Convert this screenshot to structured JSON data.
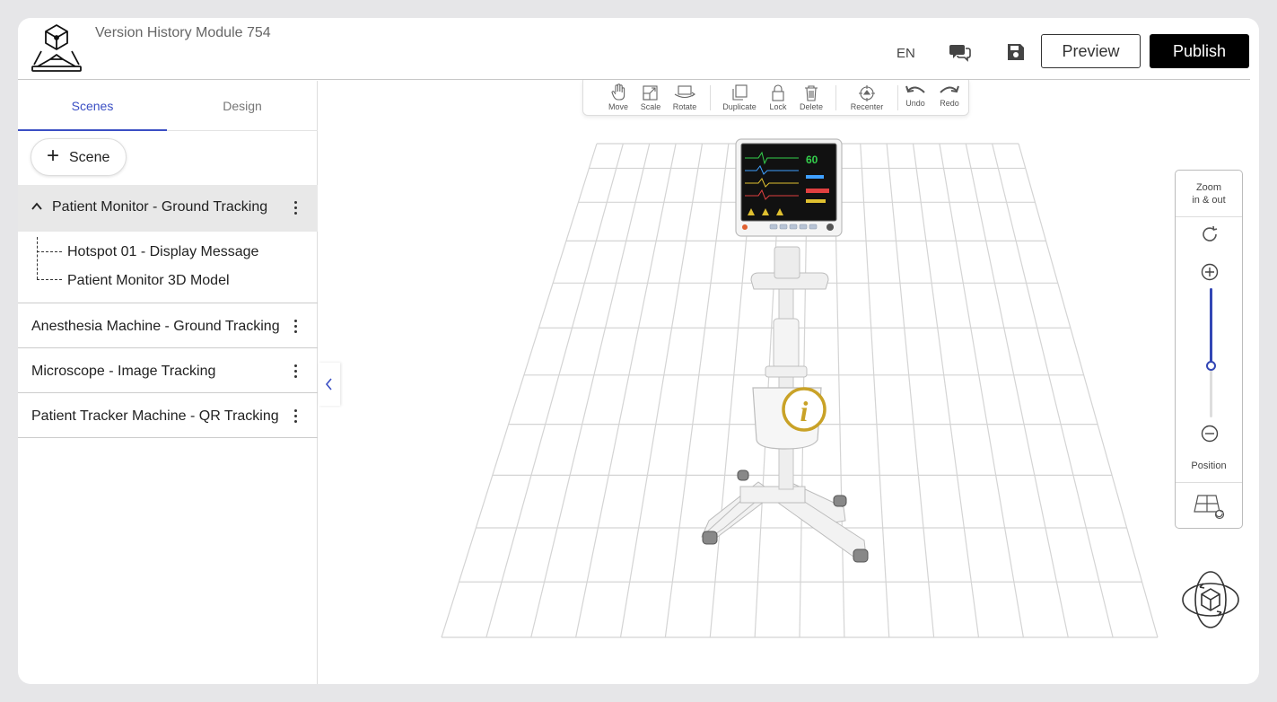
{
  "header": {
    "title": "Version History Module 754",
    "language": "EN",
    "preview_label": "Preview",
    "publish_label": "Publish"
  },
  "sidebar": {
    "tabs": [
      {
        "label": "Scenes",
        "active": true
      },
      {
        "label": "Design",
        "active": false
      }
    ],
    "add_scene_label": "Scene",
    "active_scene": {
      "name": "Patient Monitor - Ground Tracking",
      "children": [
        "Hotspot 01 - Display Message",
        "Patient Monitor 3D Model"
      ]
    },
    "scenes": [
      "Anesthesia Machine - Ground Tracking",
      "Microscope - Image Tracking",
      "Patient Tracker Machine - QR Tracking"
    ]
  },
  "toolbar": {
    "move": "Move",
    "scale": "Scale",
    "rotate": "Rotate",
    "duplicate": "Duplicate",
    "lock": "Lock",
    "delete": "Delete",
    "recenter": "Recenter",
    "undo": "Undo",
    "redo": "Redo"
  },
  "zoom_panel": {
    "title_line1": "Zoom",
    "title_line2": "in & out",
    "zoom_level": 0.6,
    "position_label": "Position"
  },
  "monitor_screen": {
    "hr": "60"
  },
  "colors": {
    "accent": "#3b4fc4",
    "hotspot": "#c9a227",
    "publish": "#000000"
  },
  "icons": {
    "logo": "ar-cube-logo-icon",
    "chat": "chat-icon",
    "save": "floppy-disk-icon",
    "reset": "refresh-icon",
    "zoom_in": "plus-circle-icon",
    "zoom_out": "minus-circle-icon",
    "position": "floor-reset-icon",
    "view_orbit": "orbit-cube-icon",
    "hotspot": "info-icon"
  }
}
